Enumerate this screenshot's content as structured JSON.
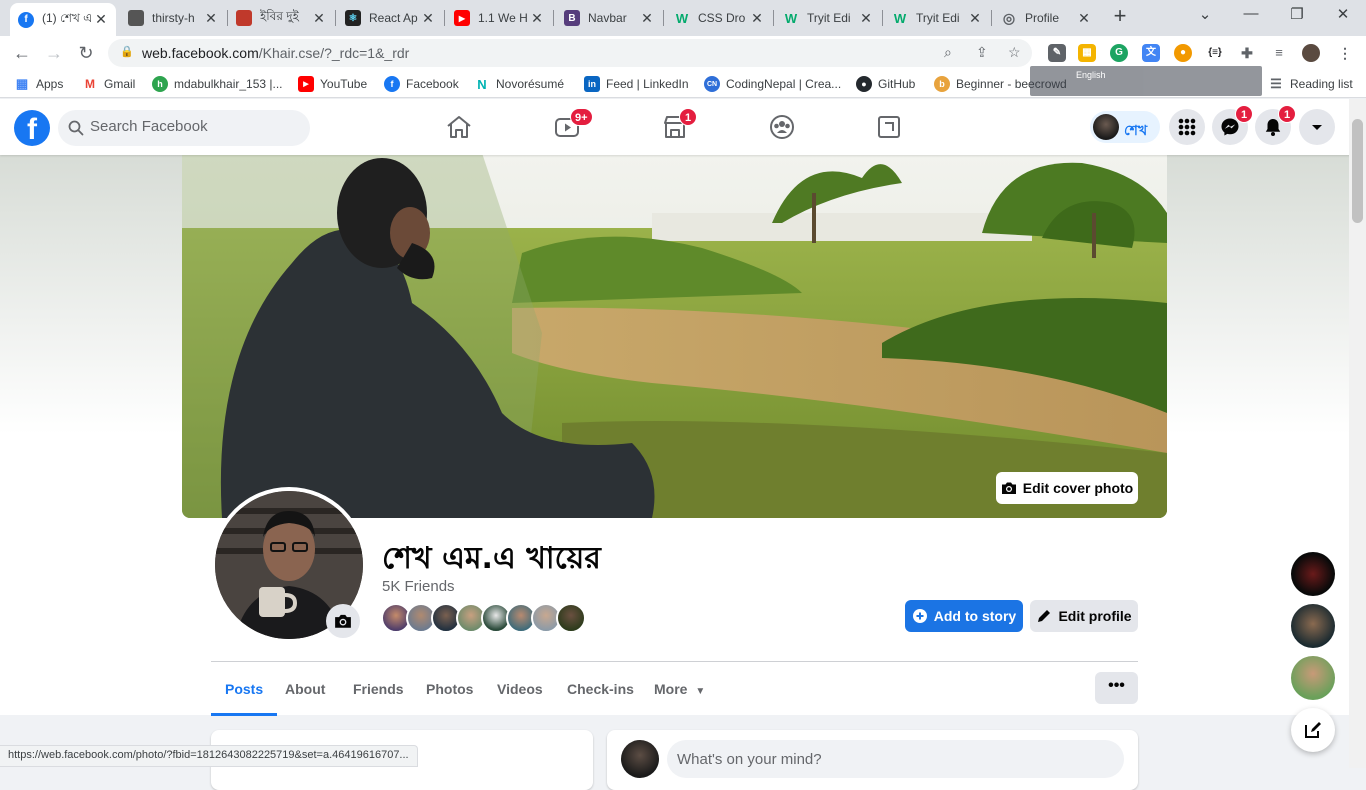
{
  "browser": {
    "tabs": [
      {
        "title": "(1) শেখ এ",
        "color": "#1877f2",
        "glyph": "f",
        "active": true
      },
      {
        "title": "thirsty-h",
        "color": "#555",
        "glyph": "",
        "active": false
      },
      {
        "title": "ইবির দুই",
        "color": "#c0392b",
        "glyph": "",
        "active": false
      },
      {
        "title": "React Ap",
        "color": "#222",
        "glyph": "⚛",
        "active": false
      },
      {
        "title": "1.1 We H",
        "color": "#ff0000",
        "glyph": "▶",
        "active": false
      },
      {
        "title": "Navbar",
        "color": "#563d7c",
        "glyph": "B",
        "active": false
      },
      {
        "title": "CSS Dro",
        "color": "#04aa6d",
        "glyph": "W",
        "active": false
      },
      {
        "title": "Tryit Edi",
        "color": "#04aa6d",
        "glyph": "W",
        "active": false
      },
      {
        "title": "Tryit Edi",
        "color": "#04aa6d",
        "glyph": "W",
        "active": false
      },
      {
        "title": "Profile",
        "color": "#5f6368",
        "glyph": "◎",
        "active": false
      }
    ],
    "url_host": "web.facebook.com",
    "url_path": "/Khair.cse/?_rdc=1&_rdr",
    "bookmarks": [
      {
        "label": "Apps",
        "color": "#4285f4"
      },
      {
        "label": "Gmail",
        "color": "#ea4335"
      },
      {
        "label": "mdabulkhair_153 |...",
        "color": "#2ea44f"
      },
      {
        "label": "YouTube",
        "color": "#ff0000"
      },
      {
        "label": "Facebook",
        "color": "#1877f2"
      },
      {
        "label": "Novorésumé",
        "color": "#00b3b3"
      },
      {
        "label": "Feed | LinkedIn",
        "color": "#0a66c2"
      },
      {
        "label": "CodingNepal | Crea...",
        "color": "#2f6fd8"
      },
      {
        "label": "GitHub",
        "color": "#24292e"
      },
      {
        "label": "Beginner - beecrowd",
        "color": "#e8a33d"
      }
    ],
    "reading_list": "Reading list",
    "translate_lang": "English",
    "status_url": "https://web.facebook.com/photo/?fbid=1812643082225719&set=a.46419616707..."
  },
  "facebook": {
    "search_placeholder": "Search Facebook",
    "watch_badge": "9+",
    "marketplace_badge": "1",
    "messenger_badge": "1",
    "notifications_badge": "1",
    "chip_name": "শেখ",
    "profile_name": "শেখ এম.এ খায়ের",
    "friends_count": "5K Friends",
    "edit_cover": "Edit cover photo",
    "add_story": "Add to story",
    "edit_profile": "Edit profile",
    "tabs": [
      "Posts",
      "About",
      "Friends",
      "Photos",
      "Videos",
      "Check-ins",
      "More"
    ],
    "more_dots": "•••",
    "composer_placeholder": "What's on your mind?"
  },
  "colors": {
    "brand": "#1877f2",
    "badge": "#e41e3f"
  }
}
